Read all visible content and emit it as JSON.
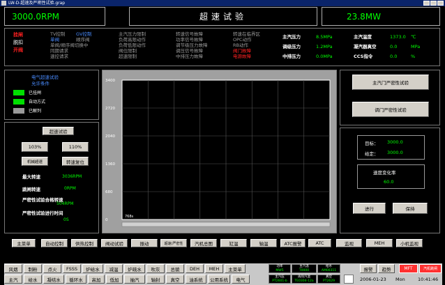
{
  "window": {
    "title": "LW-D-超速及严密性试验.grap"
  },
  "header": {
    "speed": "3000.0RPM",
    "title": "超速试验",
    "power": "23.8MW"
  },
  "status": {
    "col1": [
      "挂闸",
      "脱扣",
      "开阀"
    ],
    "col2": [
      {
        "text": "TV控制",
        "color": "#9a9a9a"
      },
      {
        "text": "GV控制",
        "color": "#4a8cff"
      },
      {
        "text": "单阀",
        "color": "#4a8cff"
      },
      {
        "text": "顺序阀",
        "color": "#9a9a9a"
      },
      {
        "text": "单阀/顺序阀切换中",
        "color": "#9a9a9a"
      },
      {
        "text": "同期请求",
        "color": "#9a9a9a"
      },
      {
        "text": "速控请求",
        "color": "#9a9a9a"
      }
    ],
    "col3": [
      "主汽压力限制",
      "负荷高限动作",
      "负荷低限动作",
      "阀位限制",
      "超速限制"
    ],
    "col4": [
      "转速信号故障",
      "功率信号故障",
      "调节级压力故障",
      "调压信号故障",
      "中排压力故障"
    ],
    "col5": [
      {
        "text": "转速在临界区",
        "color": "#9a9a9a"
      },
      {
        "text": "OPC动作",
        "color": "#9a9a9a"
      },
      {
        "text": "RB动作",
        "color": "#9a9a9a"
      },
      {
        "text": "阀门故障",
        "color": "#ff2020"
      },
      {
        "text": "电源故障",
        "color": "#ff2020"
      }
    ],
    "pressures": [
      {
        "label": "主汽压力",
        "value": "8.5MPa"
      },
      {
        "label": "调级压力",
        "value": "1.2MPa"
      },
      {
        "label": "中排压力",
        "value": "0.0MPa"
      }
    ],
    "right": [
      {
        "label": "主汽温度",
        "value": "1373.0",
        "unit": "℃"
      },
      {
        "label": "凝汽器真空",
        "value": "0.0",
        "unit": "MPa"
      },
      {
        "label": "CCS指令",
        "value": "0.0",
        "unit": "%"
      }
    ]
  },
  "left_panel": {
    "title1": "电气超速试验",
    "title2": "允许条件",
    "legend": [
      {
        "label": "已挂闸",
        "color": "#00e000"
      },
      {
        "label": "自动方式",
        "color": "#00e000"
      },
      {
        "label": "已解列",
        "color": "#9a9a9a"
      }
    ]
  },
  "left_ctrl": {
    "overspeed_btn": "超速试验",
    "btn_103": "103%",
    "btn_110": "110%",
    "btn_mech": "机械超速",
    "btn_reset": "转速复位",
    "max_speed_label": "最大转速",
    "max_speed_value": "3036RPM",
    "trip_speed_label": "跳闸转速",
    "trip_speed_value": "0RPM",
    "tight_ok_label": "严密性试验合格转速",
    "tight_ok_value": "504RPM",
    "tight_time_label": "严密性试验进行时间",
    "tight_time_value": "0S"
  },
  "chart_data": {
    "type": "line",
    "y_ticks": [
      "3400",
      "2720",
      "2040",
      "1360",
      "680",
      "0"
    ],
    "ylim": [
      0,
      3400
    ],
    "x_start_label": "768s",
    "series": []
  },
  "right_panel": {
    "btn_main": "主汽门严密性试验",
    "btn_gov": "调门严密性试验",
    "target_label": "目标：",
    "target_value": "3000.0",
    "setpoint_label": "给定：",
    "setpoint_value": "3000.0",
    "rate_label": "速度变化率",
    "rate_value": "60.0",
    "btn_run": "进行",
    "btn_hold": "保持"
  },
  "nav": [
    "主菜单",
    "自动控制",
    "供热控制",
    "阀动试验",
    "振动",
    "超速/严密性",
    "汽机总图",
    "缸温",
    "轴温",
    "ATC报警",
    "ATC",
    "监视",
    "MEH",
    "小机监视"
  ],
  "bottom": {
    "row1": [
      "风烟",
      "制粉",
      "点火",
      "FSSS",
      "炉给水",
      "减温",
      "炉疏水",
      "吹灰",
      "总貌",
      "DEH",
      "MEH",
      "主菜单"
    ],
    "row2": [
      "主汽",
      "给水",
      "凝结水",
      "循环水",
      "高加",
      "低加",
      "抽汽",
      "轴封",
      "真空",
      "油系统",
      "公用系统",
      "电气"
    ],
    "readouts_top": [
      {
        "label": "功率",
        "value": "MW5"
      },
      {
        "label": "主汽温",
        "value": "T0000"
      },
      {
        "label": "给水",
        "value": "AM00311"
      }
    ],
    "readouts_bot": [
      {
        "label": "主汽压",
        "value": "PT2601-b"
      },
      {
        "label": "再热汽温",
        "value": "TE0304-12a"
      },
      {
        "label": "真空",
        "value": "PT2629"
      }
    ],
    "alarm_btn": "报警",
    "trend_btn": "趋势",
    "mft_label": "MFT",
    "trip_label": "汽机跳闸",
    "date": "2006-01-23",
    "day": "Mon",
    "time": "10:41:46"
  }
}
